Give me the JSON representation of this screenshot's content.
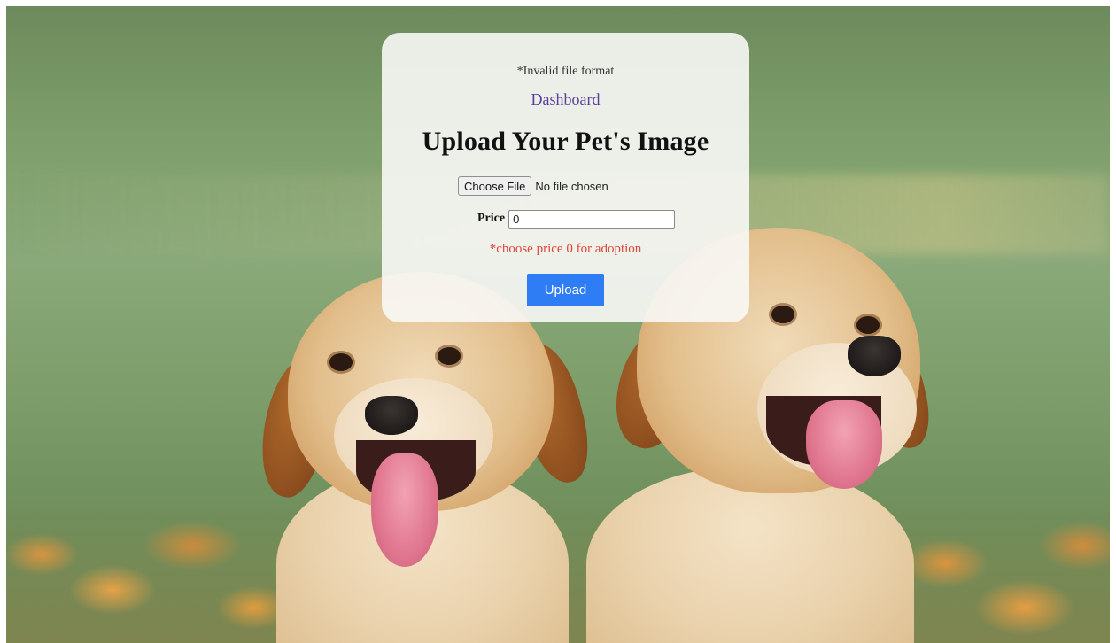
{
  "form": {
    "error_message": "*Invalid file format",
    "dashboard_link": "Dashboard",
    "heading": "Upload Your Pet's Image",
    "file_button_label": "Choose File",
    "file_status": "No file chosen",
    "price_label": "Price",
    "price_value": "0",
    "price_hint": "*choose price 0 for adoption",
    "upload_label": "Upload"
  },
  "colors": {
    "link": "#5a3e9a",
    "hint": "#e0473c",
    "upload_button": "#2e7df4",
    "card_background": "#f8f8f6"
  }
}
